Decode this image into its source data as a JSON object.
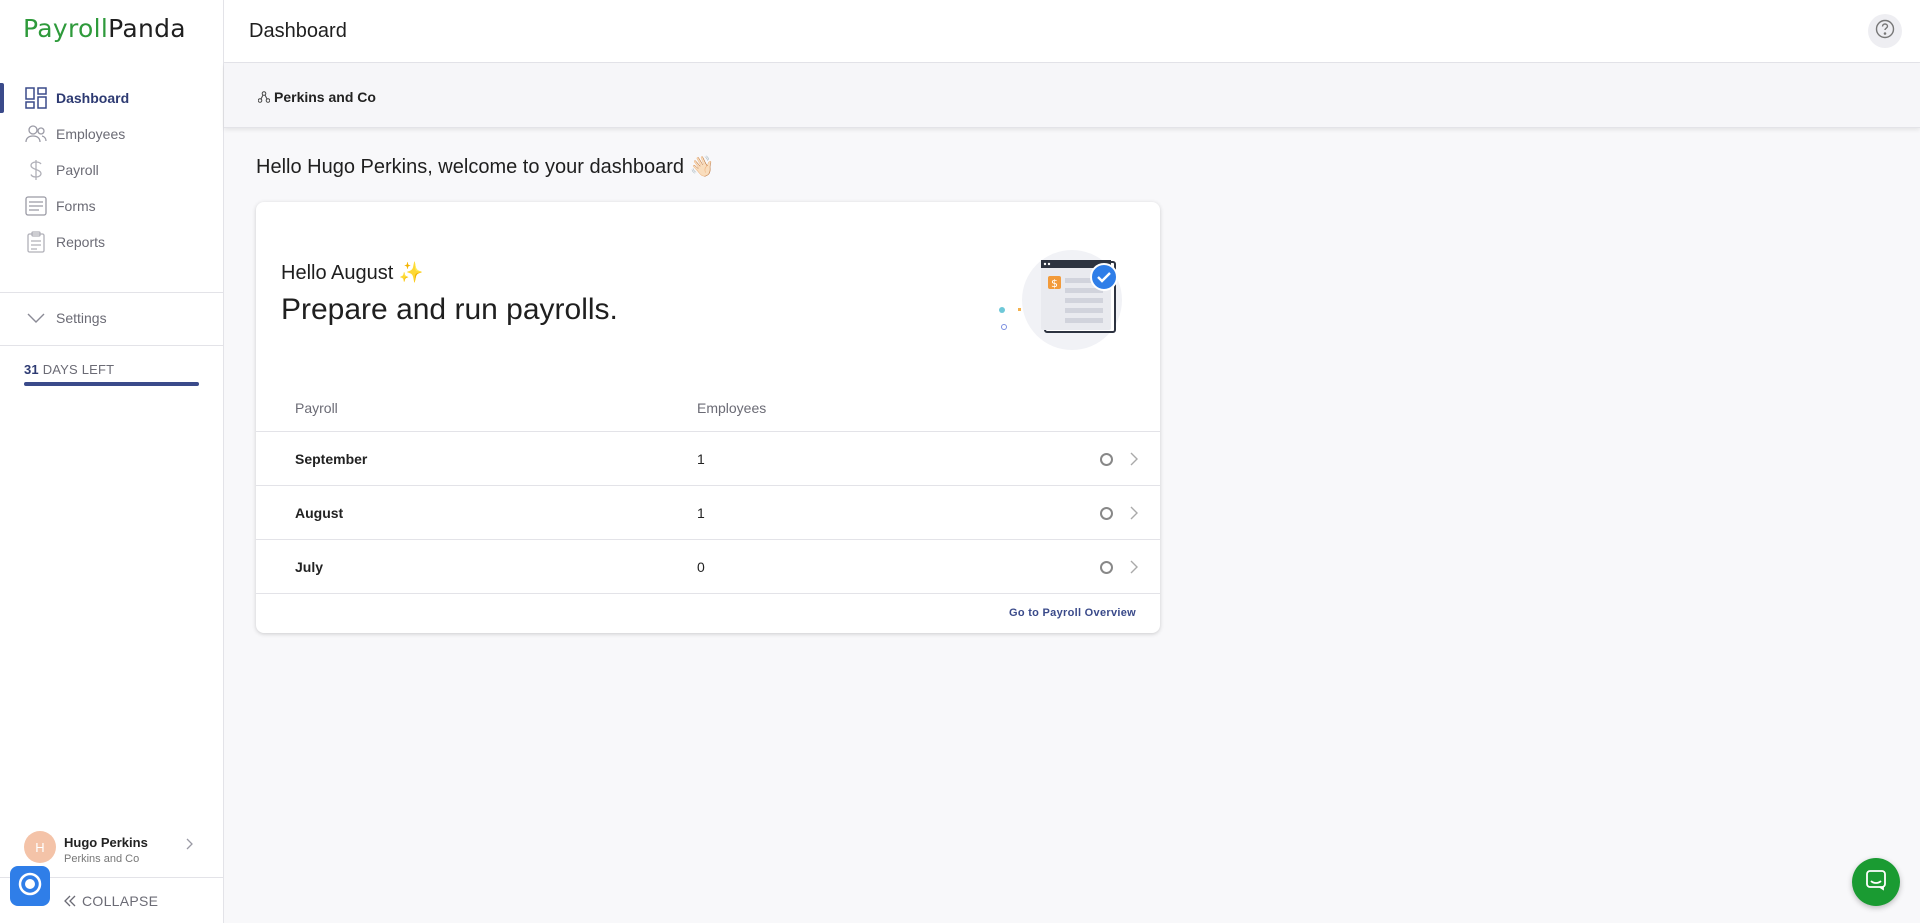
{
  "app": {
    "logo_part1": "Payroll",
    "logo_part2": "Panda",
    "brand_color": "#2e9a3b",
    "accent_color": "#3a4a8a"
  },
  "sidebar": {
    "items": [
      {
        "label": "Dashboard",
        "icon": "dashboard-icon",
        "active": true
      },
      {
        "label": "Employees",
        "icon": "users-icon",
        "active": false
      },
      {
        "label": "Payroll",
        "icon": "dollar-icon",
        "active": false
      },
      {
        "label": "Forms",
        "icon": "form-icon",
        "active": false
      },
      {
        "label": "Reports",
        "icon": "clipboard-icon",
        "active": false
      }
    ],
    "settings_label": "Settings",
    "trial": {
      "days": "31",
      "suffix": "DAYS LEFT",
      "progress": 1.0
    },
    "user": {
      "initial": "H",
      "name": "Hugo Perkins",
      "company": "Perkins and Co"
    },
    "collapse_label": "COLLAPSE"
  },
  "header": {
    "title": "Dashboard",
    "company": "Perkins and Co"
  },
  "main": {
    "welcome": "Hello Hugo Perkins, welcome to your dashboard 👋🏻",
    "card": {
      "greeting": "Hello August ✨",
      "heading": "Prepare and run payrolls.",
      "columns": [
        "Payroll",
        "Employees"
      ],
      "rows": [
        {
          "name": "September",
          "employees": "1"
        },
        {
          "name": "August",
          "employees": "1"
        },
        {
          "name": "July",
          "employees": "0"
        }
      ],
      "link": "Go to Payroll Overview"
    }
  }
}
